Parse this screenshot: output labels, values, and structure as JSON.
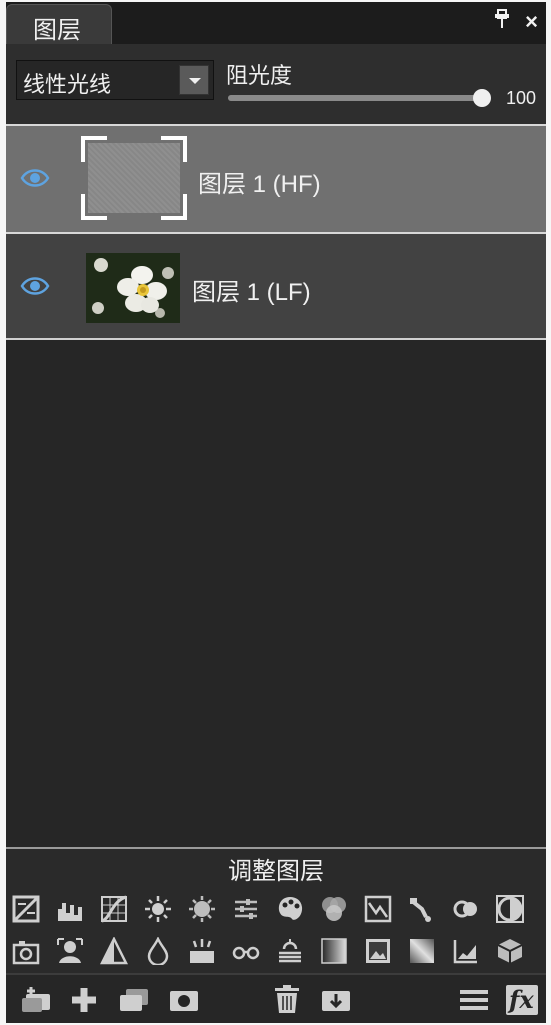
{
  "panel": {
    "tab_title": "图层",
    "pin_label": "ᵖ",
    "close_label": "×"
  },
  "controls": {
    "blend_mode": "线性光线",
    "opacity_label": "阻光度",
    "opacity_value": "100",
    "opacity_level": 1.0
  },
  "layers": [
    {
      "name": "图层 1 (HF)",
      "visible": true,
      "selected": true
    },
    {
      "name": "图层 1 (LF)",
      "visible": true,
      "selected": false
    }
  ],
  "adjustment": {
    "title": "调整图层",
    "row1_icons": [
      "exposure-icon",
      "levels-icon",
      "curves-icon",
      "brightness-icon",
      "sun-icon",
      "sliders-icon",
      "palette-icon",
      "color-balance-icon",
      "hdr-icon",
      "dropper-icon",
      "channel-mixer-icon",
      "invert-icon"
    ],
    "row2_icons": [
      "camera-icon",
      "portrait-icon",
      "threshold-icon",
      "drop-icon",
      "sparkle-icon",
      "glasses-icon",
      "haze-icon",
      "gradient-map-icon",
      "image-icon",
      "gradient-icon",
      "graph-icon",
      "cube-icon"
    ]
  },
  "toolbar": {
    "left_icons": [
      "new-layer-icon",
      "add-icon",
      "duplicate-layer-icon",
      "mask-icon"
    ],
    "center_icons": [
      "delete-icon",
      "merge-down-icon"
    ],
    "right_icons": [
      "menu-icon",
      "fx-icon"
    ],
    "fx_label": "fx"
  }
}
